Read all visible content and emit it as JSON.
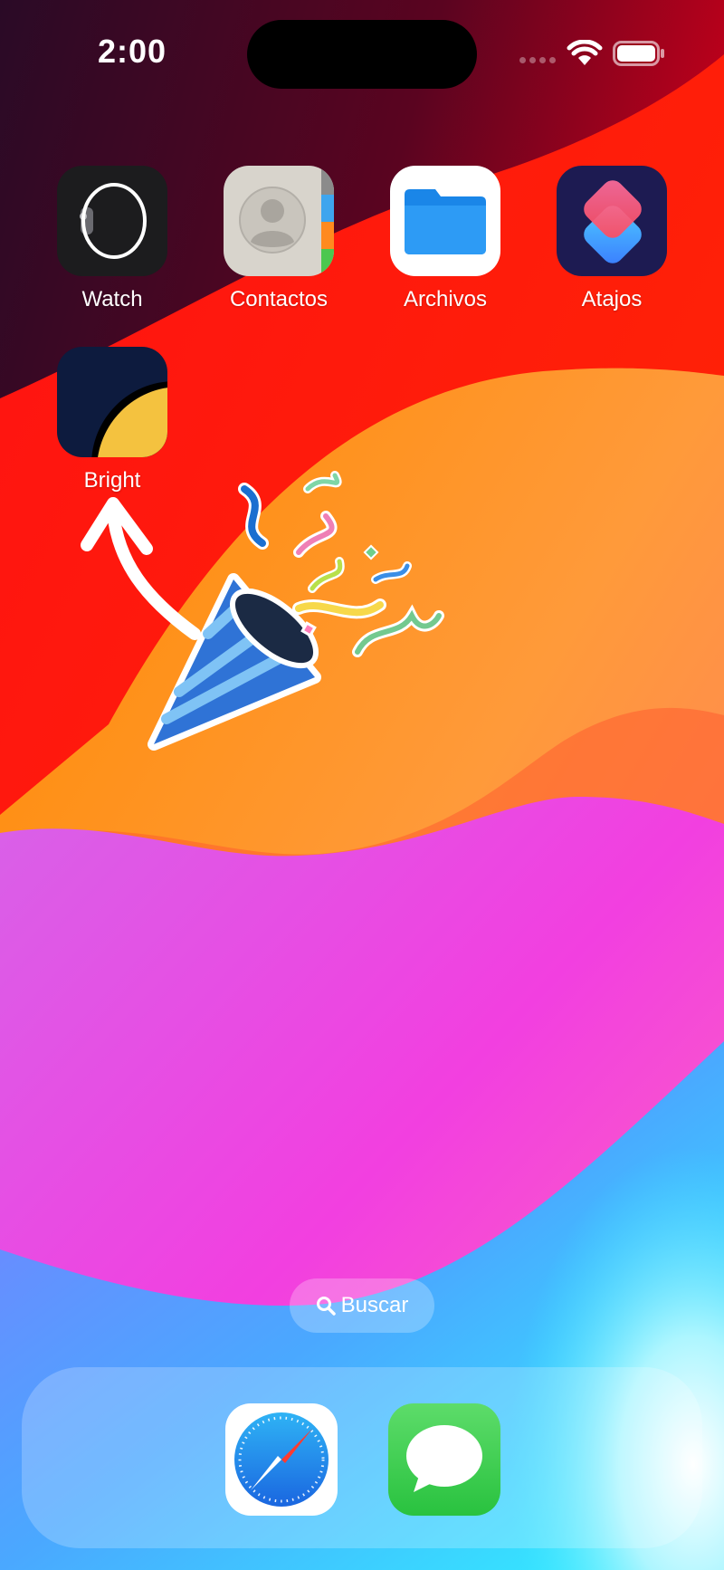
{
  "status_bar": {
    "time": "2:00",
    "icons": [
      "signal-dots-icon",
      "wifi-icon",
      "battery-icon"
    ]
  },
  "apps": [
    {
      "label": "Watch",
      "icon": "watch-icon"
    },
    {
      "label": "Contactos",
      "icon": "contacts-icon"
    },
    {
      "label": "Archivos",
      "icon": "folder-icon"
    },
    {
      "label": "Atajos",
      "icon": "shortcuts-icon"
    },
    {
      "label": "Bright",
      "icon": "bright-icon"
    }
  ],
  "search": {
    "label": "Buscar",
    "icon": "search-icon"
  },
  "dock": [
    {
      "icon": "safari-compass-icon"
    },
    {
      "icon": "messages-bubble-icon"
    }
  ],
  "overlay": {
    "icons": [
      "curved-arrow-icon",
      "party-popper-icon"
    ]
  },
  "colors": {
    "wallpaper_red": "#ff0d0d",
    "wallpaper_orange": "#ff9a1f",
    "wallpaper_magenta": "#e83de6",
    "wallpaper_cyan": "#37f3ff",
    "folder_blue": "#1e8ff0",
    "messages_green": "#35c94e",
    "bright_navy": "#0d1b3e",
    "bright_yellow": "#f4c23f"
  }
}
